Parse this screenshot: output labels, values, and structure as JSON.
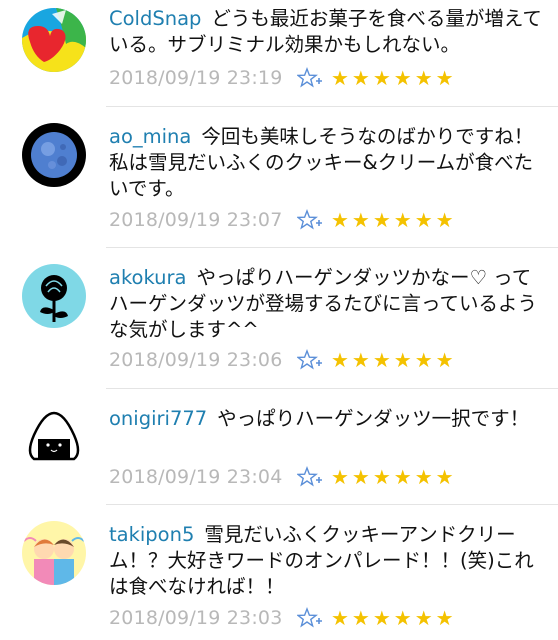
{
  "comments": [
    {
      "username": "ColdSnap",
      "text": "どうも最近お菓子を食べる量が増えている。サブリミナル効果かもしれない。",
      "timestamp": "2018/09/19 23:19",
      "stars": "★★★★★★",
      "avatar": "colorful-circle-avatar"
    },
    {
      "username": "ao_mina",
      "text": "今回も美味しそうなのばかりですね！ 私は雪見だいふくのクッキー&クリームが食べたいです。",
      "timestamp": "2018/09/19 23:07",
      "stars": "★★★★★★",
      "avatar": "full-moon-avatar"
    },
    {
      "username": "akokura",
      "text": "やっぱりハーゲンダッツかなー♡ ってハーゲンダッツが登場するたびに言っているような気がします^^",
      "timestamp": "2018/09/19 23:06",
      "stars": "★★★★★★",
      "avatar": "black-rose-avatar"
    },
    {
      "username": "onigiri777",
      "text": "やっぱりハーゲンダッツ一択です！",
      "timestamp": "2018/09/19 23:04",
      "stars": "★★★★★★",
      "avatar": "onigiri-avatar"
    },
    {
      "username": "takipon5",
      "text": "雪見だいふくクッキーアンドクリーム！？大好きワードのオンパレード！！(笑)これは食べなければ！！",
      "timestamp": "2018/09/19 23:03",
      "stars": "★★★★★★",
      "avatar": "two-kids-avatar"
    }
  ],
  "colors": {
    "username": "#1f7fb0",
    "timestamp": "#b8b8b8",
    "star": "#f4c200",
    "add_star_icon": "#5b8fd8"
  }
}
